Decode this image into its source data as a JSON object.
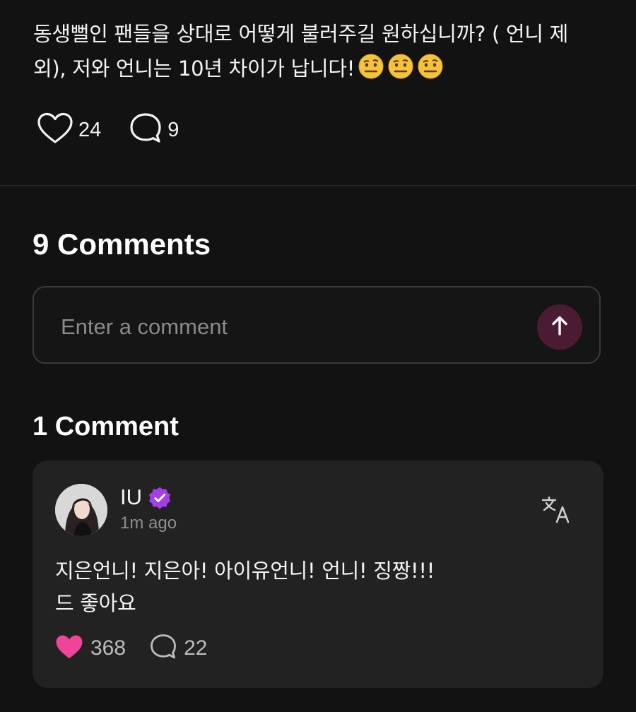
{
  "post": {
    "text": "동생뻘인 팬들을 상대로 어떻게 불러주길 원하십니까? ( 언니 제외), 저와 언니는 10년 차이가 납니다!",
    "emoji_icons": [
      "face-with-raised-eyebrow-emoji",
      "face-with-raised-eyebrow-emoji",
      "face-with-raised-eyebrow-emoji"
    ],
    "like_count": "24",
    "comment_count": "9"
  },
  "comments_section": {
    "heading": "9 Comments",
    "input_placeholder": "Enter a comment",
    "send_icon": "arrow-up-icon"
  },
  "reply_section": {
    "heading": "1 Comment"
  },
  "comment": {
    "author": "IU",
    "verified_icon": "verified-badge-icon",
    "timestamp": "1m ago",
    "translate_icon": "translate-icon",
    "body_line1": "지은언니! 지은아! 아이유언니! 언니! 징짱!!!",
    "body_line2": "드 좋아요",
    "like_count": "368",
    "reply_count": "22"
  },
  "colors": {
    "background": "#121212",
    "card": "#222222",
    "accent_pink": "#f0439a",
    "verified_purple": "#a33ee8",
    "send_button_bg": "#4a1b33"
  }
}
